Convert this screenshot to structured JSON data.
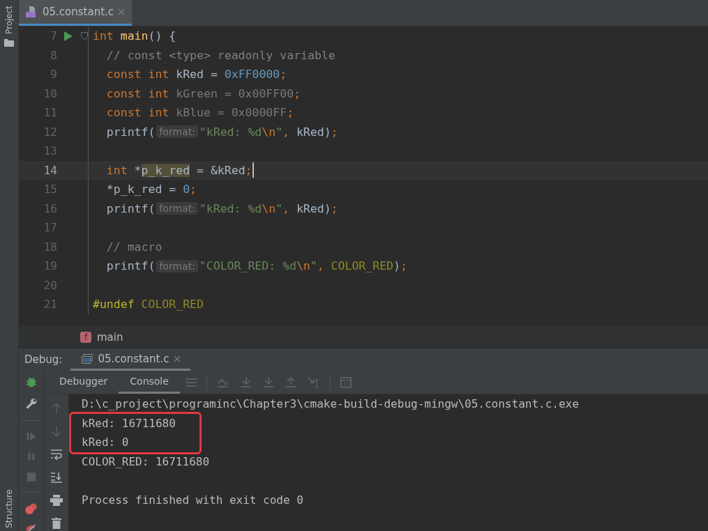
{
  "tool_strip": {
    "top_label": "Project",
    "bottom_label": "Structure"
  },
  "editor_tabs": [
    {
      "label": "05.constant.c",
      "selected": true
    }
  ],
  "code_lines": [
    {
      "number": "7",
      "run_marker": true,
      "fold": true,
      "tokens": [
        {
          "kind": "keyword",
          "text": "int"
        },
        {
          "kind": "function",
          "text": " main"
        },
        {
          "kind": "plain",
          "text": "() {"
        }
      ]
    },
    {
      "number": "8",
      "tokens": [
        {
          "kind": "comment",
          "text": "  // const <type> readonly variable"
        }
      ]
    },
    {
      "number": "9",
      "tokens": [
        {
          "kind": "keyword",
          "text": "  const int"
        },
        {
          "kind": "plain",
          "text": " kRed = "
        },
        {
          "kind": "number",
          "text": "0xFF0000"
        },
        {
          "kind": "keyword",
          "text": ";"
        }
      ]
    },
    {
      "number": "10",
      "tokens": [
        {
          "kind": "keyword",
          "text": "  const int"
        },
        {
          "kind": "unused",
          "text": " kGreen = 0x00FF00"
        },
        {
          "kind": "keyword",
          "text": ";"
        }
      ]
    },
    {
      "number": "11",
      "tokens": [
        {
          "kind": "keyword",
          "text": "  const int"
        },
        {
          "kind": "unused",
          "text": " kBlue = 0x0000FF"
        },
        {
          "kind": "keyword",
          "text": ";"
        }
      ]
    },
    {
      "number": "12",
      "tokens": [
        {
          "kind": "plain",
          "text": "  printf("
        },
        {
          "kind": "hint",
          "text": "format:"
        },
        {
          "kind": "string",
          "text": "\"kRed: %d"
        },
        {
          "kind": "escape",
          "text": "\\n"
        },
        {
          "kind": "string",
          "text": "\""
        },
        {
          "kind": "keyword",
          "text": ","
        },
        {
          "kind": "plain",
          "text": " kRed)"
        },
        {
          "kind": "keyword",
          "text": ";"
        }
      ]
    },
    {
      "number": "13"
    },
    {
      "number": "14",
      "current": true,
      "tokens": [
        {
          "kind": "keyword",
          "text": "  int"
        },
        {
          "kind": "plain",
          "text": " *"
        },
        {
          "kind": "usage",
          "text": "p_k_red"
        },
        {
          "kind": "plain",
          "text": " = &kRed"
        },
        {
          "kind": "keyword",
          "text": ";"
        }
      ]
    },
    {
      "number": "15",
      "tokens": [
        {
          "kind": "plain",
          "text": "  *p_k_red = "
        },
        {
          "kind": "number",
          "text": "0"
        },
        {
          "kind": "keyword",
          "text": ";"
        }
      ]
    },
    {
      "number": "16",
      "tokens": [
        {
          "kind": "plain",
          "text": "  printf("
        },
        {
          "kind": "hint",
          "text": "format:"
        },
        {
          "kind": "string",
          "text": "\"kRed: %d"
        },
        {
          "kind": "escape",
          "text": "\\n"
        },
        {
          "kind": "string",
          "text": "\""
        },
        {
          "kind": "keyword",
          "text": ","
        },
        {
          "kind": "plain",
          "text": " kRed)"
        },
        {
          "kind": "keyword",
          "text": ";"
        }
      ]
    },
    {
      "number": "17"
    },
    {
      "number": "18",
      "tokens": [
        {
          "kind": "comment",
          "text": "  // macro"
        }
      ]
    },
    {
      "number": "19",
      "tokens": [
        {
          "kind": "plain",
          "text": "  printf("
        },
        {
          "kind": "hint",
          "text": "format:"
        },
        {
          "kind": "string",
          "text": "\"COLOR_RED: %d"
        },
        {
          "kind": "escape",
          "text": "\\n"
        },
        {
          "kind": "string",
          "text": "\""
        },
        {
          "kind": "keyword",
          "text": ","
        },
        {
          "kind": "macro",
          "text": " COLOR_RED"
        },
        {
          "kind": "plain",
          "text": ")"
        },
        {
          "kind": "keyword",
          "text": ";"
        }
      ]
    },
    {
      "number": "20"
    },
    {
      "number": "21",
      "tokens": [
        {
          "kind": "directive",
          "text": "#undef"
        },
        {
          "kind": "macro",
          "text": " COLOR_RED"
        }
      ]
    }
  ],
  "breadcrumb": {
    "badge": "f",
    "label": "main"
  },
  "debug": {
    "title": "Debug:",
    "tabs": [
      {
        "label": "05.constant.c",
        "selected": true
      }
    ],
    "subtabs": [
      {
        "label": "Debugger",
        "selected": false
      },
      {
        "label": "Console",
        "selected": true
      }
    ],
    "output_groups": [
      {
        "lines": [
          "D:\\c_project\\programinc\\Chapter3\\cmake-build-debug-mingw\\05.constant.c.exe"
        ]
      },
      {
        "boxed": true,
        "lines": [
          "kRed: 16711680",
          "kRed: 0"
        ]
      },
      {
        "lines": [
          "COLOR_RED: 16711680"
        ]
      },
      {
        "gap_before": true,
        "lines": [
          "Process finished with exit code 0"
        ]
      }
    ]
  }
}
